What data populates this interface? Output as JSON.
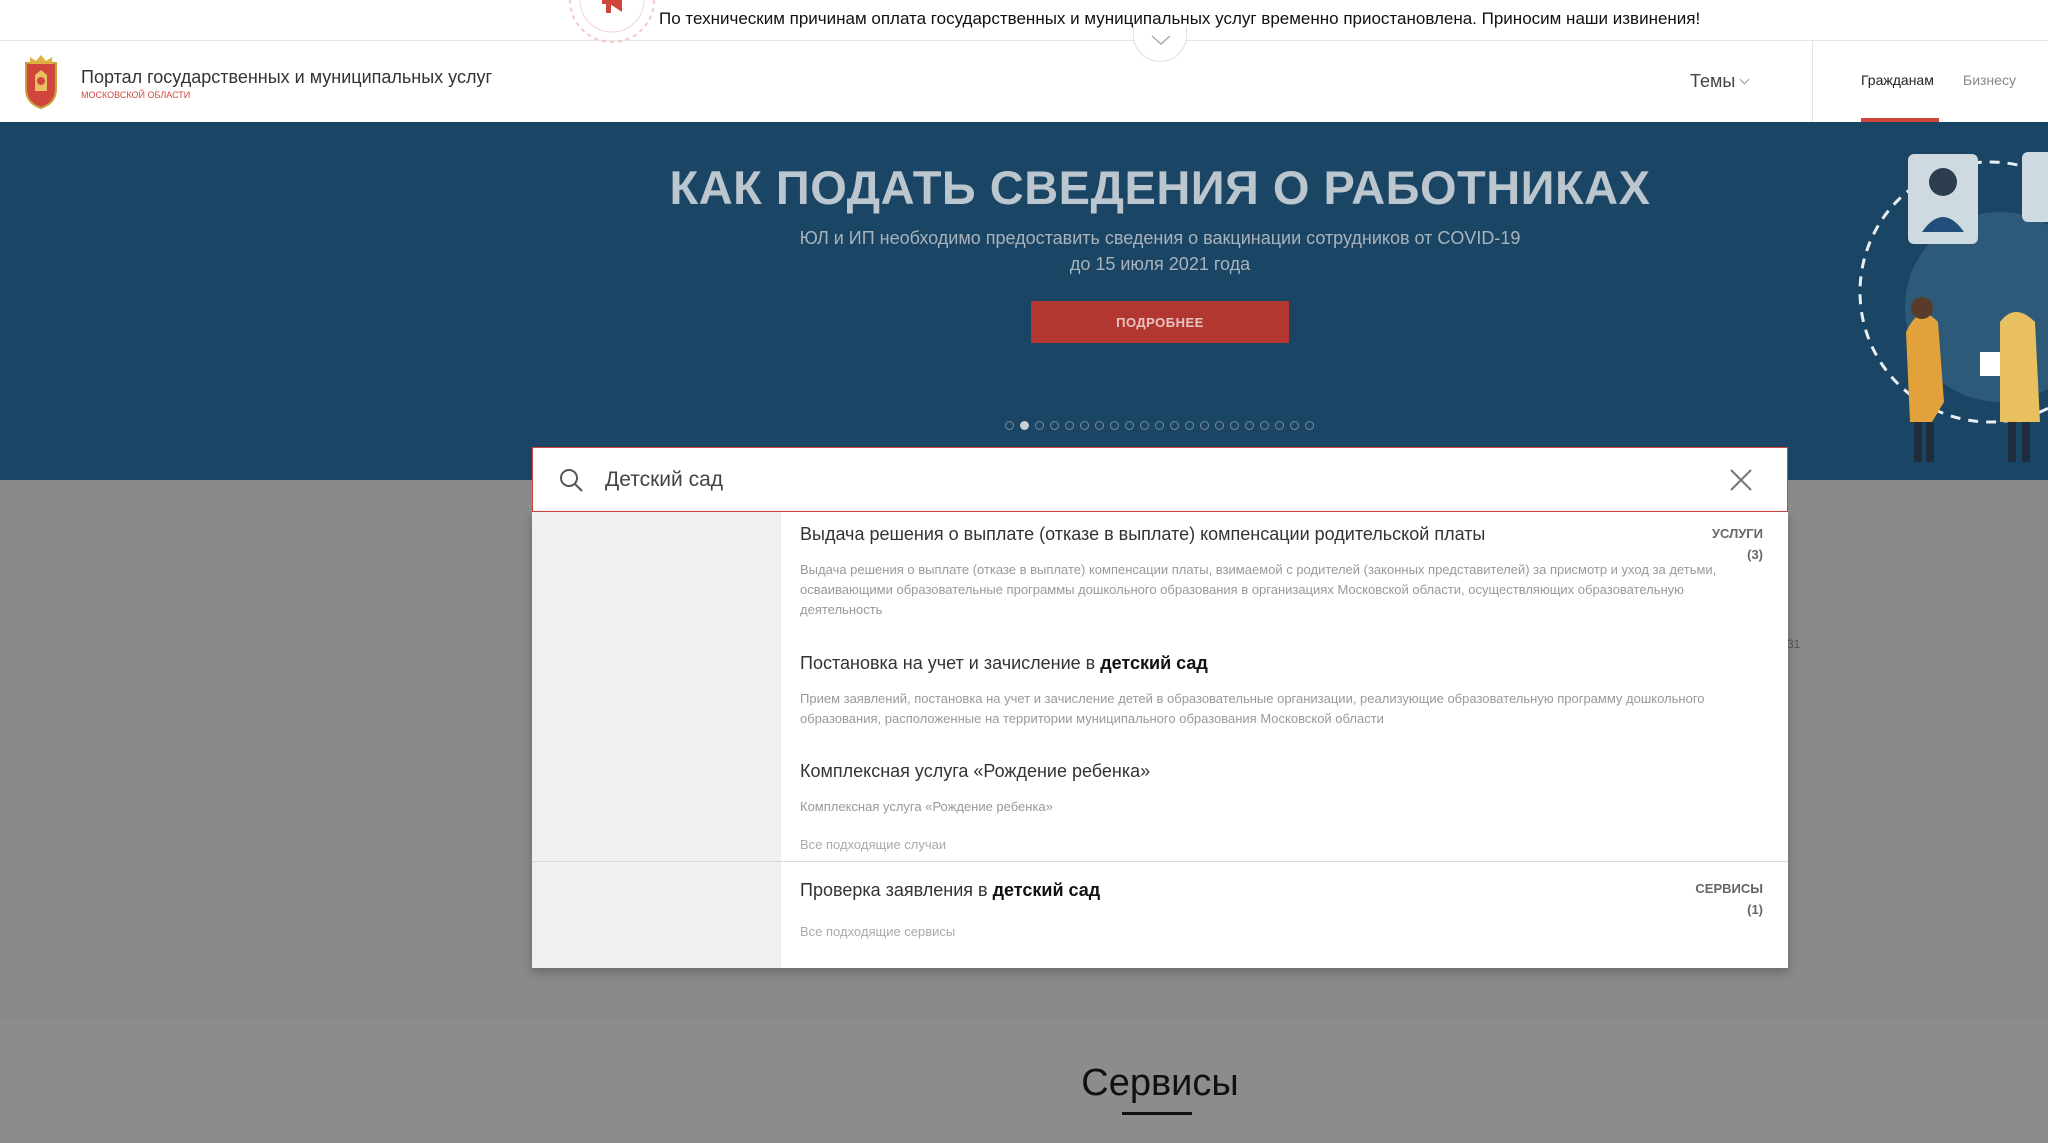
{
  "notice": {
    "text": "По техническим причинам оплата государственных и муниципальных услуг временно приостановлена. Приносим наши извинения!",
    "icon": "megaphone-icon"
  },
  "header": {
    "title": "Портал государственных и муниципальных услуг",
    "subtitle": "МОСКОВСКОЙ ОБЛАСТИ",
    "themes_label": "Темы",
    "tabs": [
      {
        "label": "Гражданам",
        "active": true
      },
      {
        "label": "Бизнесу",
        "active": false
      }
    ],
    "accent_color": "#d0463c"
  },
  "banner": {
    "title": "КАК ПОДАТЬ СВЕДЕНИЯ О РАБОТНИКАХ",
    "subtitle_line1": "ЮЛ и ИП необходимо предоставить сведения о вакцинации сотрудников от COVID-19",
    "subtitle_line2": "до 15 июля 2021 года",
    "button_label": "ПОДРОБНЕЕ",
    "slide_count": 21,
    "active_slide": 2,
    "background_color": "#1a4564"
  },
  "search": {
    "value": "Детский сад",
    "placeholder": ""
  },
  "results": {
    "services": {
      "label": "УСЛУГИ",
      "count": "(3)",
      "items": [
        {
          "title": "Выдача решения о выплате (отказе в выплате) компенсации родительской платы",
          "title_prefix": "",
          "title_bold": "",
          "description": "Выдача решения о выплате (отказе в выплате) компенсации платы, взимаемой с родителей (законных представителей) за присмотр и уход за детьми, осваивающими образовательные программы дошкольного образования в организациях Московской области, осуществляющих образовательную деятельность"
        },
        {
          "title": "",
          "title_prefix": "Постановка на учет и зачисление в ",
          "title_bold": "детский сад",
          "description": "Прием заявлений, постановка на учет и зачисление детей в образовательные организации, реализующие образовательную программу дошкольного образования, расположенные на территории муниципального образования Московской области"
        },
        {
          "title": "Комплексная услуга «Рождение ребенка»",
          "title_prefix": "",
          "title_bold": "",
          "description": "Комплексная услуга «Рождение ребенка»"
        }
      ],
      "more_label": "Все подходящие случаи"
    },
    "tools": {
      "label": "СЕРВИСЫ",
      "count": "(1)",
      "items": [
        {
          "title_prefix": "Проверка заявления в ",
          "title_bold": "детский сад"
        }
      ],
      "more_label": "Все подходящие сервисы"
    }
  },
  "page": {
    "section_title": "Сервисы",
    "side_fragment": "31"
  }
}
